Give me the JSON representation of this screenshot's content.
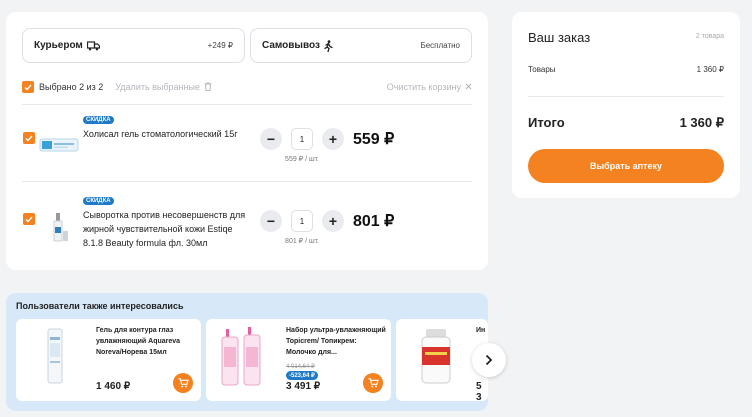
{
  "delivery": {
    "courier": {
      "label": "Курьером",
      "price": "+249 ₽"
    },
    "pickup": {
      "label": "Самовывоз",
      "price": "Бесплатно"
    }
  },
  "selection": {
    "selected_text": "Выбрано 2 из 2",
    "delete_label": "Удалить выбранные",
    "clear_label": "Очистить корзину"
  },
  "items": [
    {
      "badge": "СКИДКА",
      "name": "Холисал гель стоматологический 15г",
      "qty": "1",
      "unit_price": "559 ₽ / шт.",
      "total": "559 ₽"
    },
    {
      "badge": "СКИДКА",
      "name": "Сыворотка против несовершенств для жирной чувствительной кожи Estiqe 8.1.8 Beauty formula фл. 30мл",
      "qty": "1",
      "unit_price": "801 ₽ / шт.",
      "total": "801 ₽"
    }
  ],
  "order": {
    "title": "Ваш заказ",
    "count": "2 товара",
    "goods_label": "Товары",
    "goods_value": "1 360 ₽",
    "total_label": "Итого",
    "total_value": "1 360 ₽",
    "button": "Выбрать аптеку"
  },
  "also": {
    "title": "Пользователи также интересовались",
    "cards": [
      {
        "name": "Гель для контура глаз увлажняющий Aquareva Noreva/Норева 15мл",
        "old_price": "",
        "discount": "",
        "price": "1 460 ₽"
      },
      {
        "name": "Набор ультра-увлажняющий Topicrem/ Топикрем: Молочко для...",
        "old_price": "4 014,64 ₽",
        "discount": "-523,64 ₽",
        "price": "3 491 ₽"
      },
      {
        "name": "Ин",
        "old_price": "",
        "discount": "",
        "price": "5 3"
      }
    ]
  },
  "colors": {
    "accent": "#f58220",
    "badge": "#1e7ac8",
    "also_bg": "#d7e8f8"
  }
}
